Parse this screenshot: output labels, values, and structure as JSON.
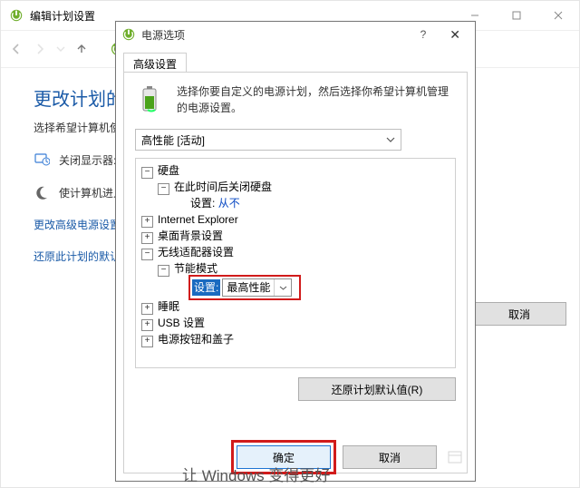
{
  "back": {
    "window_title": "编辑计划设置",
    "page_title": "更改计划的设",
    "subtitle": "选择希望计算机使",
    "row_display_off": "关闭显示器:",
    "row_sleep": "使计算机进入睡",
    "link_adv": "更改高级电源设置",
    "link_restore": "还原此计划的默认",
    "btn_cancel": "取消"
  },
  "dlg": {
    "title": "电源选项",
    "tab_label": "高级设置",
    "desc": "选择你要自定义的电源计划，然后选择你希望计算机管理的电源设置。",
    "plan_selected": "高性能 [活动]",
    "restore_defaults": "还原计划默认值(R)",
    "btn_ok": "确定",
    "btn_cancel": "取消"
  },
  "tree": {
    "n0": "硬盘",
    "n0_0": "在此时间后关闭硬盘",
    "n0_0_k": "设置:",
    "n0_0_v": "从不",
    "n1": "Internet Explorer",
    "n2": "桌面背景设置",
    "n3": "无线适配器设置",
    "n3_0": "节能模式",
    "n3_0_k": "设置:",
    "n3_0_v": "最高性能",
    "n4": "睡眠",
    "n5": "USB 设置",
    "n6": "电源按钮和盖子"
  },
  "footer_hint": "让 Windows 变得更好"
}
